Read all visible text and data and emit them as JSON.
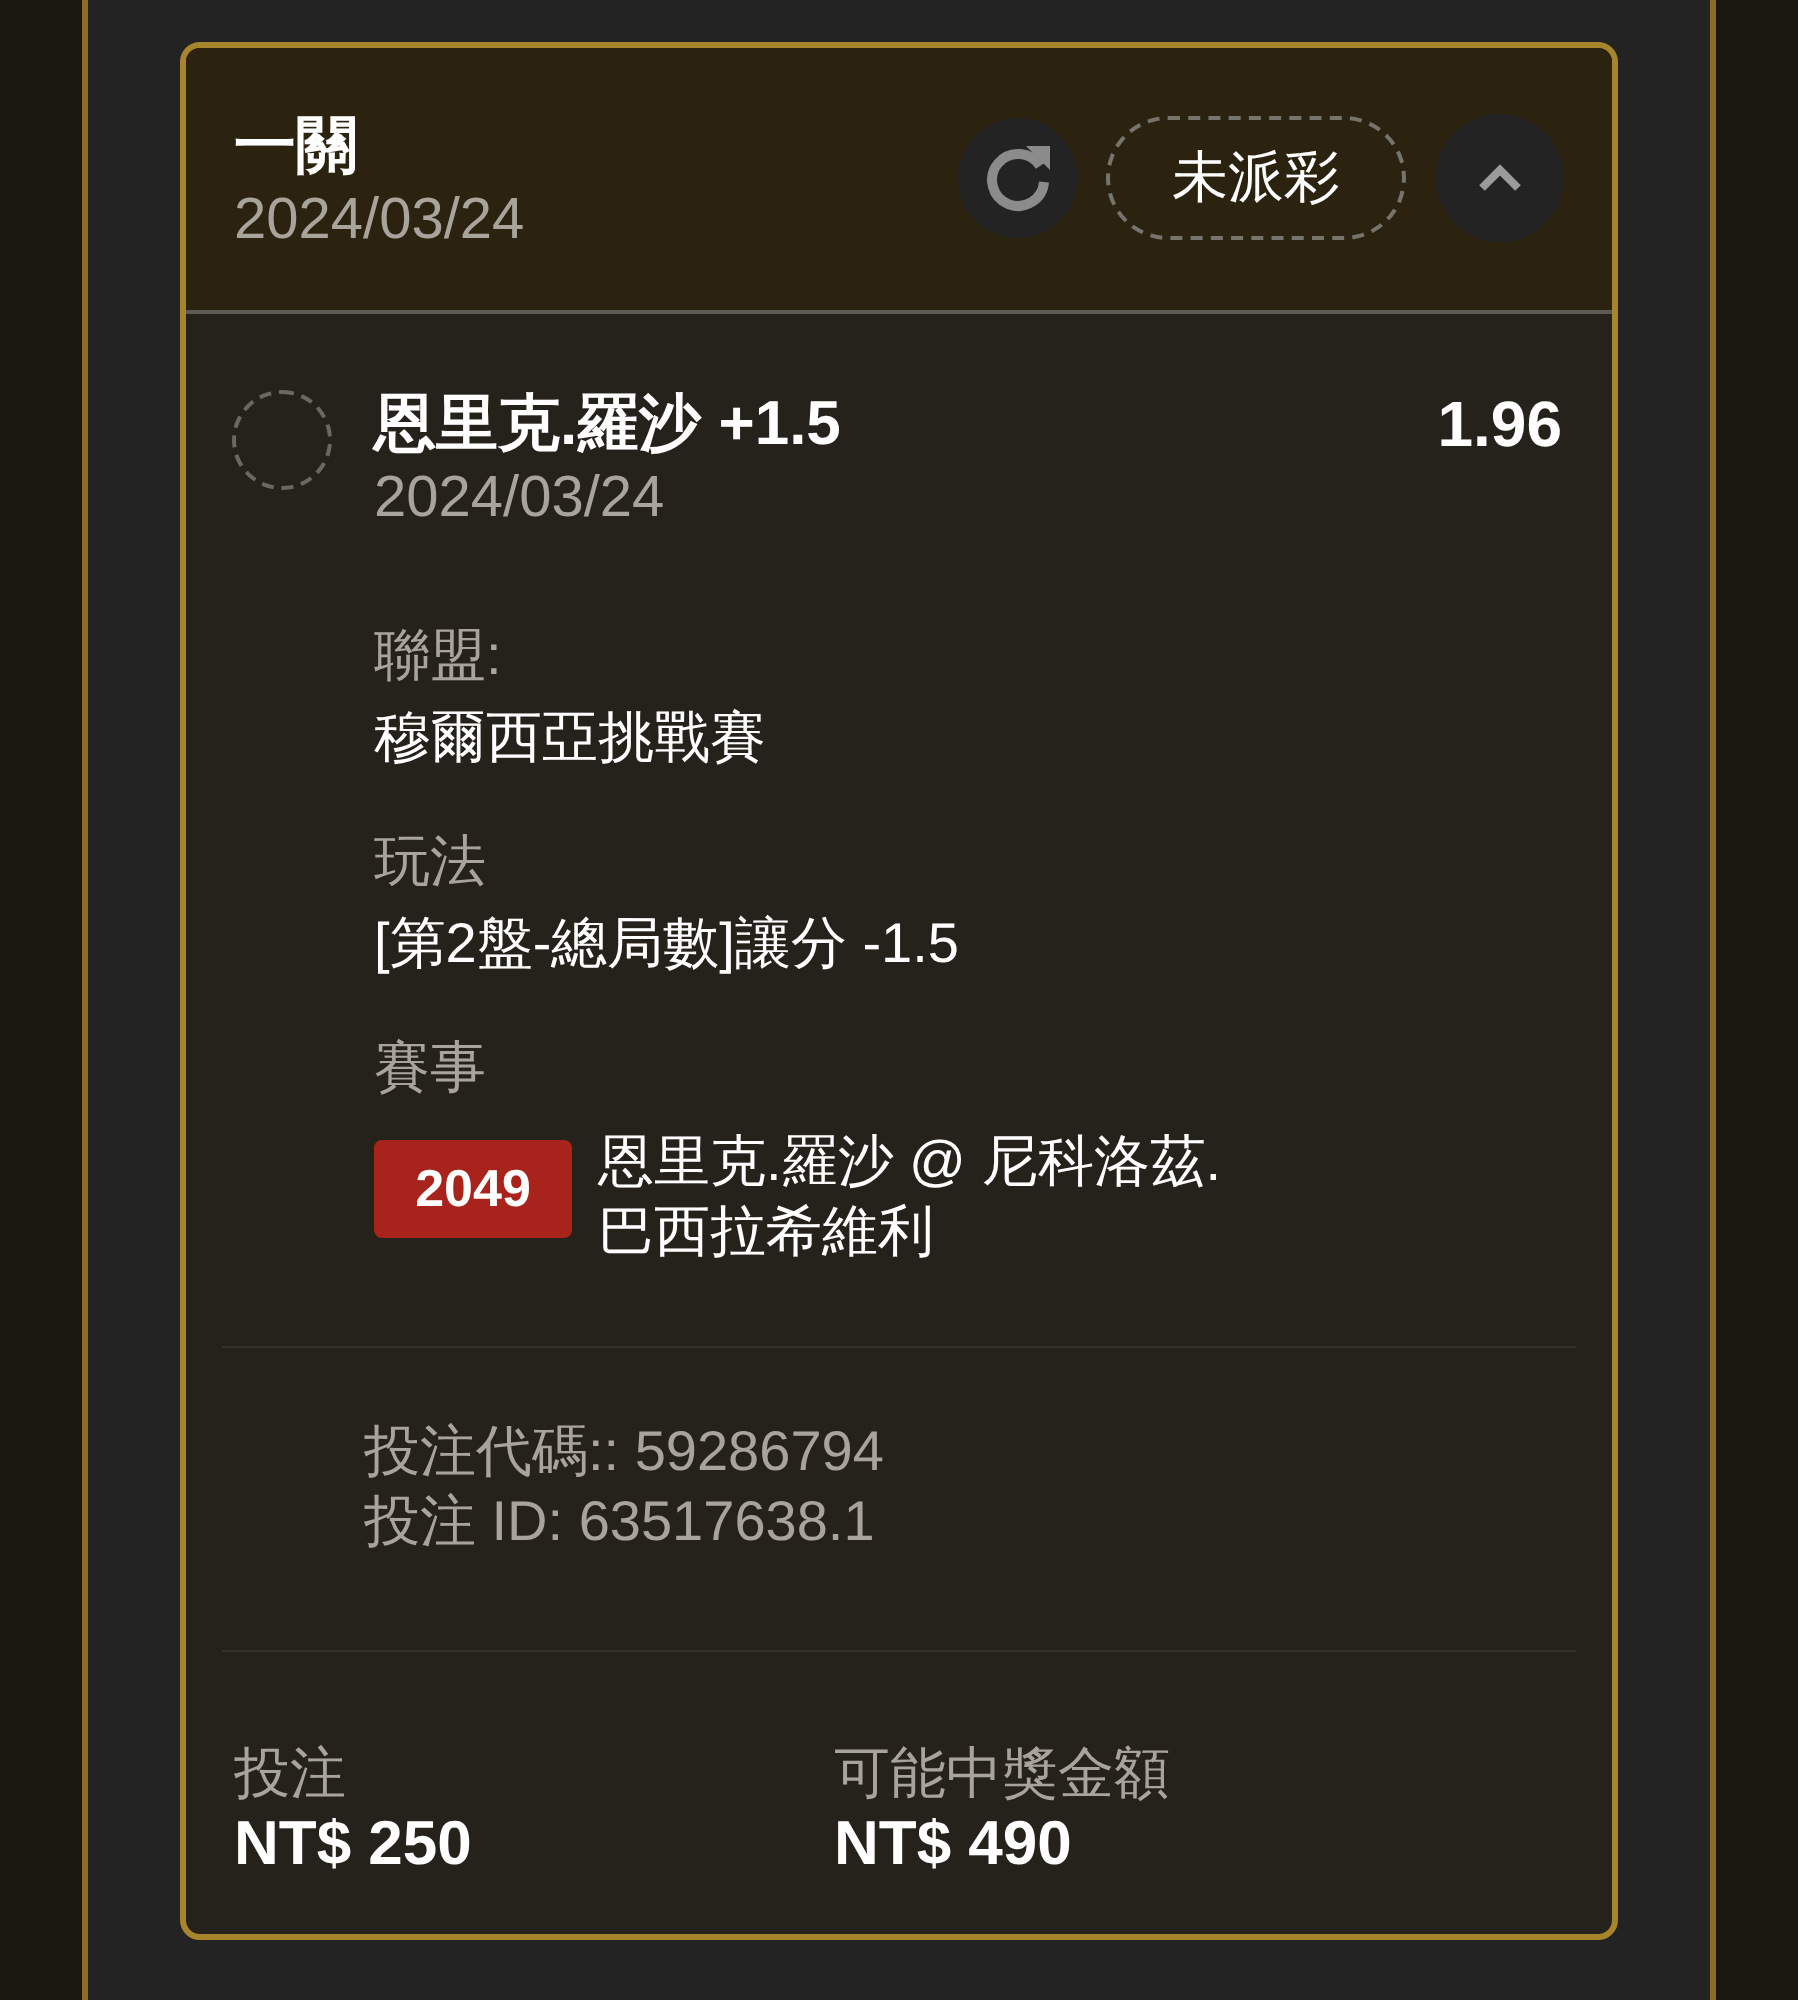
{
  "header": {
    "title": "一關",
    "date": "2024/03/24",
    "status": "未派彩",
    "expanded": true
  },
  "selection": {
    "name": "恩里克.羅沙 +1.5",
    "date": "2024/03/24",
    "odds": "1.96",
    "selected": false
  },
  "details": [
    {
      "kind": "text",
      "label": "聯盟:",
      "value": "穆爾西亞挑戰賽"
    },
    {
      "kind": "text",
      "label": "玩法",
      "value": "[第2盤-總局數]讓分 -1.5"
    },
    {
      "kind": "event",
      "label": "賽事",
      "badge": "2049",
      "value": "恩里克.羅沙 @ 尼科洛茲. 巴西拉希維利"
    }
  ],
  "codes": [
    "投注代碼:: 59286794",
    "投注 ID: 63517638.1"
  ],
  "totals": [
    {
      "label": "投注",
      "value": "NT$ 250"
    },
    {
      "label": "可能中獎金額",
      "value": "NT$ 490"
    }
  ]
}
